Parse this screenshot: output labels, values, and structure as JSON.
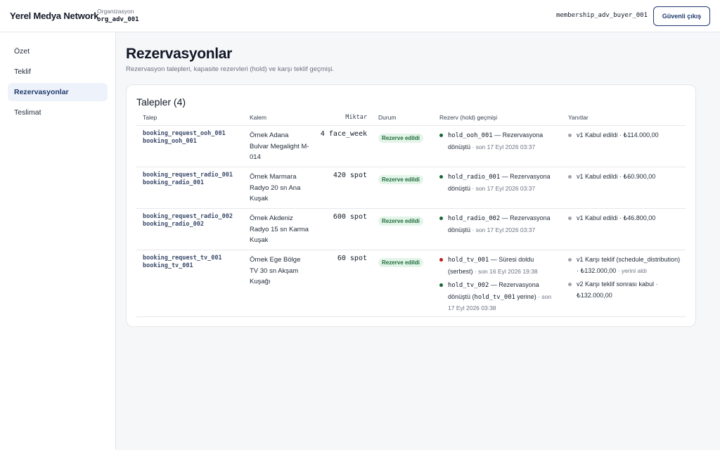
{
  "header": {
    "brand": "Yerel Medya Network",
    "org_label": "Organizasyon",
    "org_value": "org_adv_001",
    "user": "membership_adv_buyer_001",
    "logout_label": "Güvenli çıkış"
  },
  "sidebar": {
    "items": [
      {
        "label": "Özet"
      },
      {
        "label": "Teklif"
      },
      {
        "label": "Rezervasyonlar"
      },
      {
        "label": "Teslimat"
      }
    ],
    "active": "Rezervasyonlar"
  },
  "page": {
    "title": "Rezervasyonlar",
    "subtitle": "Rezervasyon talepleri, kapasite rezervleri (hold) ve karşı teklif geçmişi."
  },
  "table": {
    "title": "Talepler (4)",
    "columns": {
      "request": "Talep",
      "item": "Kalem",
      "qty": "Miktar",
      "status": "Durum",
      "hold": "Rezerv (hold) geçmişi",
      "responses": "Yanıtlar"
    },
    "rows": [
      {
        "request_id": "booking_request_ooh_001",
        "booking_id": "booking_ooh_001",
        "item": "Örnek Adana Bulvar Megalight M-014",
        "qty": "4 face_week",
        "status": "Rezerve edildi",
        "holds": [
          {
            "code": "hold_ooh_001",
            "text": " — Rezervasyona dönüştü",
            "time": " · son 17 Eyl 2026 03:37",
            "color": "green"
          }
        ],
        "responses": [
          {
            "text": "v1 Kabul edildi · ₺114.000,00"
          }
        ]
      },
      {
        "request_id": "booking_request_radio_001",
        "booking_id": "booking_radio_001",
        "item": "Örnek Marmara Radyo 20 sn Ana Kuşak",
        "qty": "420 spot",
        "status": "Rezerve edildi",
        "holds": [
          {
            "code": "hold_radio_001",
            "text": " — Rezervasyona dönüştü",
            "time": " · son 17 Eyl 2026 03:37",
            "color": "green"
          }
        ],
        "responses": [
          {
            "text": "v1 Kabul edildi · ₺60.900,00"
          }
        ]
      },
      {
        "request_id": "booking_request_radio_002",
        "booking_id": "booking_radio_002",
        "item": "Örnek Akdeniz Radyo 15 sn Karma Kuşak",
        "qty": "600 spot",
        "status": "Rezerve edildi",
        "holds": [
          {
            "code": "hold_radio_002",
            "text": " — Rezervasyona dönüştü",
            "time": " · son 17 Eyl 2026 03:37",
            "color": "green"
          }
        ],
        "responses": [
          {
            "text": "v1 Kabul edildi · ₺46.800,00"
          }
        ]
      },
      {
        "request_id": "booking_request_tv_001",
        "booking_id": "booking_tv_001",
        "item": "Örnek Ege Bölge TV 30 sn Akşam Kuşağı",
        "qty": "60 spot",
        "status": "Rezerve edildi",
        "holds": [
          {
            "code": "hold_tv_001",
            "text": " — Süresi doldu (serbest)",
            "time": " · son 16 Eyl 2026 19:38",
            "color": "red"
          },
          {
            "code": "hold_tv_002",
            "text": " — Rezervasyona dönüştü (",
            "code2": "hold_tv_001",
            "text2": " yerine)",
            "time": " · son 17 Eyl 2026 03:38",
            "color": "green"
          }
        ],
        "responses": [
          {
            "text": "v1 Karşı teklif (schedule_distribution) · ₺132.000,00",
            "extra": " · yerini aldı"
          },
          {
            "text": "v2 Karşı teklif sonrası kabul · ₺132.000,00"
          }
        ]
      }
    ]
  }
}
